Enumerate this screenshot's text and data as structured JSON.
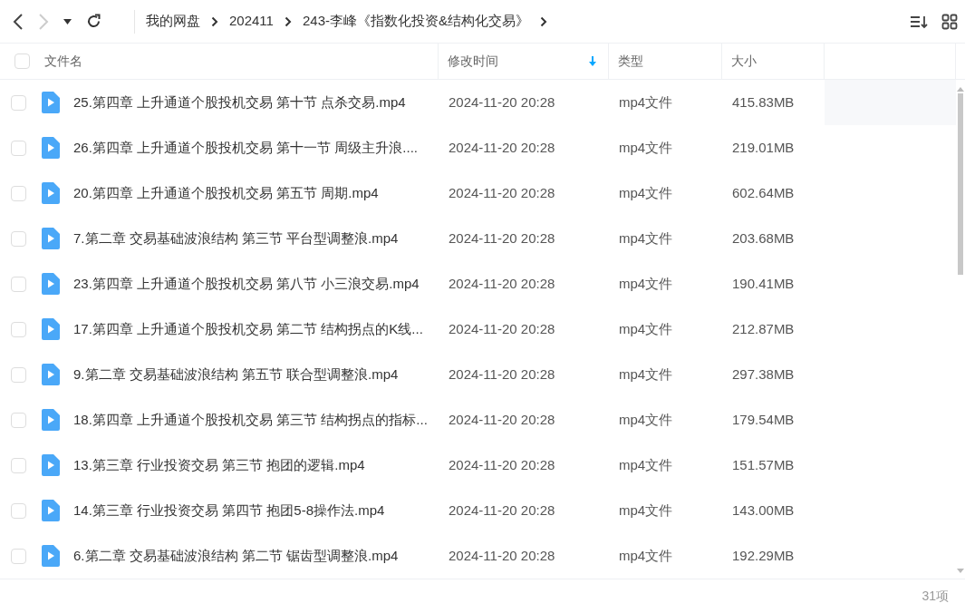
{
  "nav": {
    "back_disabled": false,
    "forward_disabled": true
  },
  "breadcrumb": [
    "我的网盘",
    "202411",
    "243-李峰《指数化投资&结构化交易》"
  ],
  "columns": [
    {
      "label": "文件名",
      "sorted": false
    },
    {
      "label": "修改时间",
      "sorted": true
    },
    {
      "label": "类型",
      "sorted": false
    },
    {
      "label": "大小",
      "sorted": false
    }
  ],
  "select_all": {
    "checked": false
  },
  "rows": [
    {
      "name": "25.第四章 上升通道个股投机交易 第十节 点杀交易.mp4",
      "modified": "2024-11-20 20:28",
      "type": "mp4文件",
      "size": "415.83MB",
      "checked": false,
      "hovered": true
    },
    {
      "name": "26.第四章 上升通道个股投机交易 第十一节 周级主升浪....",
      "modified": "2024-11-20 20:28",
      "type": "mp4文件",
      "size": "219.01MB",
      "checked": false,
      "hovered": false
    },
    {
      "name": "20.第四章 上升通道个股投机交易 第五节 周期.mp4",
      "modified": "2024-11-20 20:28",
      "type": "mp4文件",
      "size": "602.64MB",
      "checked": false,
      "hovered": false
    },
    {
      "name": "7.第二章 交易基础波浪结构 第三节 平台型调整浪.mp4",
      "modified": "2024-11-20 20:28",
      "type": "mp4文件",
      "size": "203.68MB",
      "checked": false,
      "hovered": false
    },
    {
      "name": "23.第四章 上升通道个股投机交易 第八节 小三浪交易.mp4",
      "modified": "2024-11-20 20:28",
      "type": "mp4文件",
      "size": "190.41MB",
      "checked": false,
      "hovered": false
    },
    {
      "name": "17.第四章 上升通道个股投机交易 第二节 结构拐点的K线...",
      "modified": "2024-11-20 20:28",
      "type": "mp4文件",
      "size": "212.87MB",
      "checked": false,
      "hovered": false
    },
    {
      "name": "9.第二章 交易基础波浪结构 第五节 联合型调整浪.mp4",
      "modified": "2024-11-20 20:28",
      "type": "mp4文件",
      "size": "297.38MB",
      "checked": false,
      "hovered": false
    },
    {
      "name": "18.第四章 上升通道个股投机交易 第三节 结构拐点的指标...",
      "modified": "2024-11-20 20:28",
      "type": "mp4文件",
      "size": "179.54MB",
      "checked": false,
      "hovered": false
    },
    {
      "name": "13.第三章 行业投资交易 第三节 抱团的逻辑.mp4",
      "modified": "2024-11-20 20:28",
      "type": "mp4文件",
      "size": "151.57MB",
      "checked": false,
      "hovered": false
    },
    {
      "name": "14.第三章 行业投资交易 第四节 抱团5-8操作法.mp4",
      "modified": "2024-11-20 20:28",
      "type": "mp4文件",
      "size": "143.00MB",
      "checked": false,
      "hovered": false
    },
    {
      "name": "6.第二章 交易基础波浪结构 第二节 锯齿型调整浪.mp4",
      "modified": "2024-11-20 20:28",
      "type": "mp4文件",
      "size": "192.29MB",
      "checked": false,
      "hovered": false
    }
  ],
  "status_bar": {
    "count": "31项"
  }
}
